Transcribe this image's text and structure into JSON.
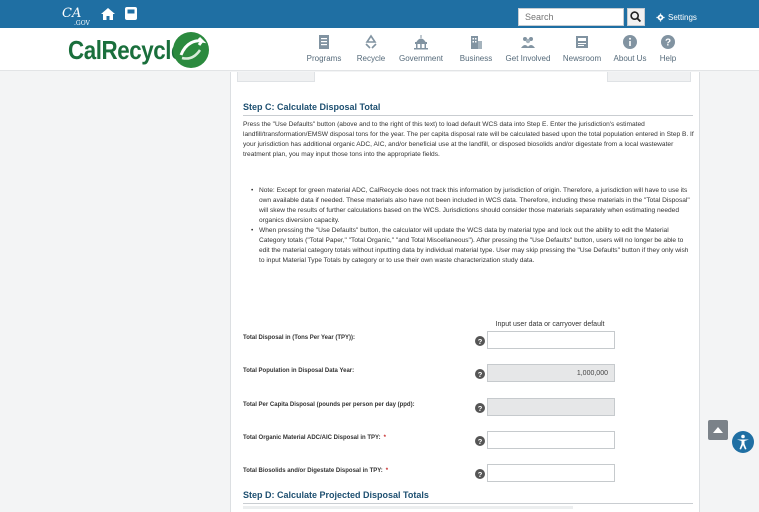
{
  "topbar": {
    "ca_logo_text": "CA",
    "ca_logo_sub": ".GOV",
    "search_placeholder": "Search",
    "settings_label": "Settings"
  },
  "header": {
    "brand": "CalRecycle",
    "nav": [
      {
        "label": "Programs",
        "icon": "document-icon"
      },
      {
        "label": "Recycle",
        "icon": "recycle-icon"
      },
      {
        "label": "Government",
        "icon": "capitol-icon"
      },
      {
        "label": "Business",
        "icon": "building-icon"
      },
      {
        "label": "Get Involved",
        "icon": "people-icon"
      },
      {
        "label": "Newsroom",
        "icon": "news-icon"
      },
      {
        "label": "About Us",
        "icon": "info-icon"
      },
      {
        "label": "Help",
        "icon": "help-icon"
      }
    ]
  },
  "stepC": {
    "heading": "Step C: Calculate Disposal Total",
    "intro": "Press the \"Use Defaults\" button (above and to the right of this text) to load default WCS data into Step E. Enter the jurisdiction's estimated landfill/transformation/EMSW disposal tons for the year. The per capita disposal rate will be calculated based upon the total population entered in Step B. If your jurisdiction has additional organic ADC, AIC, and/or beneficial use at the landfill, or disposed biosolids and/or digestate from a local wastewater treatment plan, you may input those tons into the appropriate fields.",
    "bullets": [
      "Note: Except for green material ADC, CalRecycle does not track this information by jurisdiction of origin. Therefore, a jurisdiction will have to use its own available data if needed. These materials also have not been included in WCS data. Therefore, including these materials in the \"Total Disposal\" will skew the results of further calculations based on the WCS. Jurisdictions should consider those materials separately when estimating needed organics diversion capacity.",
      "When pressing the \"Use Defaults\" button, the calculator will update the WCS data by material type and lock out the ability to edit the Material Category totals (\"Total Paper,\" \"Total Organic,\" \"and Total Miscellaneous\"). After pressing the \"Use Defaults\" button, users will no longer be able to edit the material category totals without inputting data by individual material type. User may skip pressing the \"Use Defaults\" button if they only wish to input Material Type Totals by category or to use their own waste characterization study data."
    ],
    "column_hint": "Input user data or carryover default",
    "fields": [
      {
        "label": "Total Disposal in (Tons Per Year (TPY)):",
        "value": "",
        "required": ""
      },
      {
        "label": "Total Population in Disposal Data Year:",
        "value": "1,000,000",
        "required": ""
      },
      {
        "label": "Total Per Capita Disposal (pounds per person per day (ppd):",
        "value": "",
        "required": ""
      },
      {
        "label": "Total Organic Material ADC/AIC Disposal in TPY:",
        "value": "",
        "required": "*"
      },
      {
        "label": "Total Biosolids and/or Digestate Disposal in TPY:",
        "value": "",
        "required": "*"
      }
    ]
  },
  "stepD": {
    "heading": "Step D: Calculate Projected Disposal Totals"
  },
  "colors": {
    "topbar": "#1f6fa3",
    "brand_green": "#1a6f3c",
    "heading_blue": "#1d4f70",
    "required_red": "#c62828"
  }
}
